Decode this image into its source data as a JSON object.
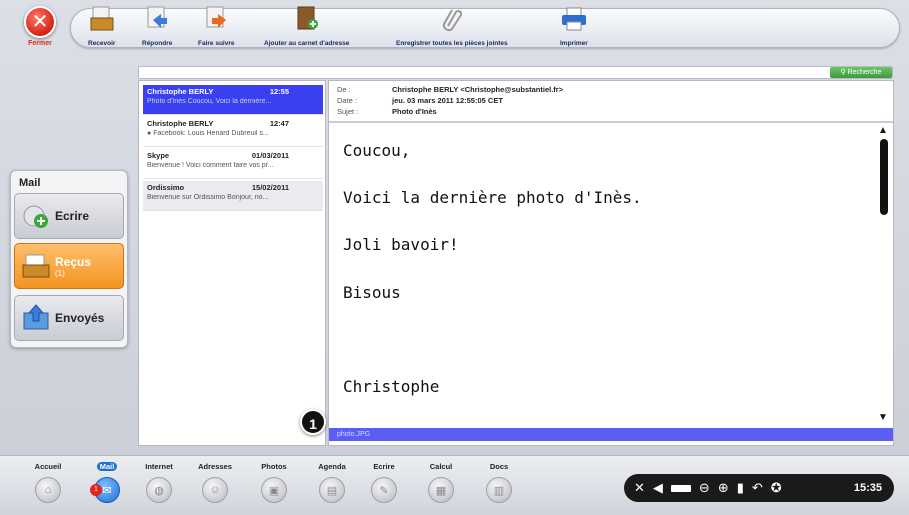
{
  "toolbar": {
    "close_label": "Fermer",
    "items": [
      {
        "label": "Recevoir",
        "icon": "receive-icon"
      },
      {
        "label": "Répondre",
        "icon": "reply-icon"
      },
      {
        "label": "Faire suivre",
        "icon": "forward-icon"
      },
      {
        "label": "Ajouter au carnet d'adresse",
        "icon": "add-contact-icon"
      },
      {
        "label": "Enregistrer toutes les pièces jointes",
        "icon": "paperclip-icon"
      },
      {
        "label": "Imprimer",
        "icon": "printer-icon"
      }
    ]
  },
  "search": {
    "button_label": "Recherche"
  },
  "mail_panel": {
    "title": "Mail",
    "folders": [
      {
        "label": "Ecrire",
        "count": ""
      },
      {
        "label": "Reçus",
        "count": "(1)"
      },
      {
        "label": "Envoyés",
        "count": ""
      }
    ]
  },
  "messages": [
    {
      "sender": "Christophe BERLY",
      "time": "12:55",
      "preview": "Photo d'Inès  Coucou, Voici la dernière..."
    },
    {
      "sender": "Christophe BERLY",
      "time": "12:47",
      "preview": "Facebook: Louis Heriard Dubreuil s..."
    },
    {
      "sender": "Skype",
      "time": "01/03/2011",
      "preview": "Bienvenue ! Voici comment faire vos pr..."
    },
    {
      "sender": "Ordissimo",
      "time": "15/02/2011",
      "preview": "Bienvenue sur Ordissimo  Bonjour, no..."
    }
  ],
  "email": {
    "from_label": "De :",
    "from": "Christophe BERLY <Christophe@substantiel.fr>",
    "date_label": "Date :",
    "date": "jeu. 03 mars 2011 12:55:05 CET",
    "subject_label": "Sujet :",
    "subject": "Photo d'Inès",
    "body": [
      "Coucou,",
      "Voici la dernière photo d'Inès.",
      "Joli bavoir!",
      "Bisous",
      "Christophe"
    ],
    "attachment": "photo.JPG"
  },
  "callout": "1",
  "dock": {
    "items": [
      {
        "label": "Accueil"
      },
      {
        "label": "Mail"
      },
      {
        "label": "Internet"
      },
      {
        "label": "Adresses"
      },
      {
        "label": "Photos"
      },
      {
        "label": "Agenda"
      },
      {
        "label": "Ecrire"
      },
      {
        "label": "Calcul"
      },
      {
        "label": "Docs"
      }
    ],
    "mail_badge": "1",
    "clock": "15:35"
  }
}
